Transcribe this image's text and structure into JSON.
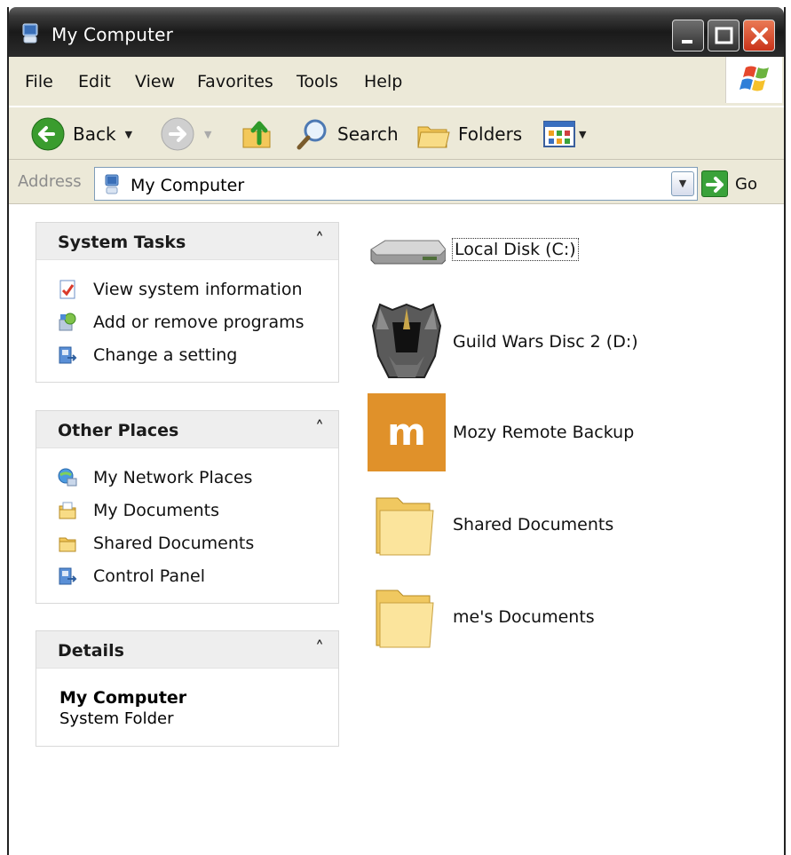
{
  "window": {
    "title": "My Computer",
    "controls": {
      "minimize": "minimize-icon",
      "maximize": "maximize-icon",
      "close": "close-icon"
    }
  },
  "menu": [
    "File",
    "Edit",
    "View",
    "Favorites",
    "Tools",
    "Help"
  ],
  "toolbar": {
    "back": "Back",
    "search": "Search",
    "folders": "Folders"
  },
  "address": {
    "label": "Address",
    "value": "My Computer",
    "go": "Go"
  },
  "panels": {
    "system_tasks": {
      "title": "System Tasks",
      "items": [
        "View system information",
        "Add or remove programs",
        "Change a setting"
      ]
    },
    "other_places": {
      "title": "Other Places",
      "items": [
        "My Network Places",
        "My Documents",
        "Shared Documents",
        "Control Panel"
      ]
    },
    "details": {
      "title": "Details",
      "name": "My Computer",
      "type": "System Folder"
    }
  },
  "items": [
    {
      "label": "Local Disk (C:)",
      "icon": "hard-disk-icon"
    },
    {
      "label": "Guild Wars Disc 2 (D:)",
      "icon": "guild-wars-helmet-icon"
    },
    {
      "label": "Mozy Remote Backup",
      "icon": "mozy-logo-icon",
      "icon_letter": "m"
    },
    {
      "label": "Shared Documents",
      "icon": "folder-icon"
    },
    {
      "label": "me's Documents",
      "icon": "folder-icon"
    }
  ],
  "colors": {
    "titlebar": "#1a1a1a",
    "chrome": "#ece9d8",
    "close_button": "#d9472a",
    "mozy_orange": "#e0912a",
    "folder_yellow": "#f6d77a"
  }
}
